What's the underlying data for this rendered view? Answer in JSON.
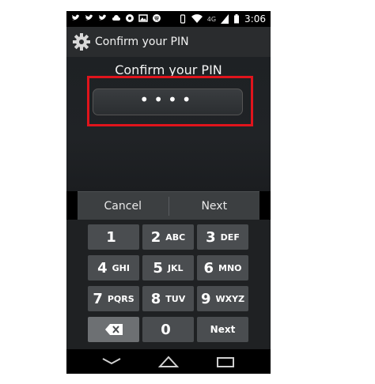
{
  "status_bar": {
    "time": "3:06",
    "network": "4G",
    "icons": [
      "twitter-icon",
      "twitter-icon",
      "twitter-icon",
      "cloud-icon",
      "chrome-icon",
      "image-icon",
      "spotify-icon",
      "vibrate-icon",
      "wifi-icon",
      "signal-icon",
      "battery-icon"
    ]
  },
  "action_bar": {
    "title": "Confirm your PIN",
    "icon": "gear-icon"
  },
  "content": {
    "prompt": "Confirm your PIN",
    "pin_value": "••••"
  },
  "buttons": {
    "cancel": "Cancel",
    "next": "Next"
  },
  "keypad": {
    "keys": [
      {
        "num": "1",
        "letters": ""
      },
      {
        "num": "2",
        "letters": "ABC"
      },
      {
        "num": "3",
        "letters": "DEF"
      },
      {
        "num": "4",
        "letters": "GHI"
      },
      {
        "num": "5",
        "letters": "JKL"
      },
      {
        "num": "6",
        "letters": "MNO"
      },
      {
        "num": "7",
        "letters": "PQRS"
      },
      {
        "num": "8",
        "letters": "TUV"
      },
      {
        "num": "9",
        "letters": "WXYZ"
      },
      {
        "num": "0",
        "letters": ""
      }
    ],
    "next_label": "Next",
    "delete_icon": "backspace-icon"
  },
  "nav_bar": {
    "icons": [
      "back-icon",
      "home-icon",
      "recents-icon"
    ]
  },
  "colors": {
    "highlight": "#e0141c",
    "action_bar": "#2a2c2e",
    "key": "#4a4d50"
  }
}
